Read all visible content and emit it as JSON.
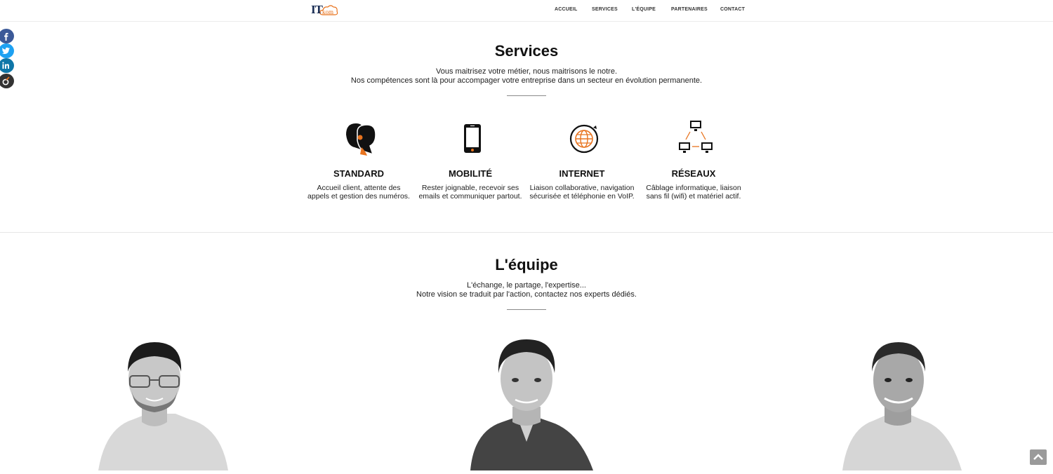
{
  "header": {
    "logo": {
      "main": "IT",
      "accent": "kom"
    },
    "nav": [
      {
        "label": "ACCUEIL"
      },
      {
        "label": "SERVICES"
      },
      {
        "label": "L'ÉQUIPE"
      },
      {
        "label": "PARTENAIRES"
      },
      {
        "label": "CONTACT"
      }
    ]
  },
  "social": [
    {
      "icon": "facebook-icon",
      "color": "#3b5998"
    },
    {
      "icon": "twitter-icon",
      "color": "#1da1f2"
    },
    {
      "icon": "linkedin-icon",
      "color": "#0e76a8"
    },
    {
      "icon": "viadeo-icon",
      "color": "#333333"
    }
  ],
  "services": {
    "title": "Services",
    "subtitle_line1": "Vous maitrisez votre métier, nous maitrisons le notre.",
    "subtitle_line2": "Nos compétences sont là pour accompager votre entreprise dans un secteur en évolution permanente.",
    "items": [
      {
        "icon": "call-center-icon",
        "title": "STANDARD",
        "desc": "Accueil client, attente des appels et gestion des numéros."
      },
      {
        "icon": "smartphone-icon",
        "title": "MOBILITÉ",
        "desc": "Rester joignable, recevoir ses emails et communiquer partout."
      },
      {
        "icon": "globe-icon",
        "title": "INTERNET",
        "desc": "Liaison collaborative, navigation sécurisée et téléphonie en VoIP."
      },
      {
        "icon": "network-icon",
        "title": "RÉSEAUX",
        "desc": "Câblage informatique, liaison sans fil (wifi) et matériel actif."
      }
    ]
  },
  "team": {
    "title": "L'équipe",
    "subtitle_line1": "L'échange, le partage, l'expertise...",
    "subtitle_line2": "Notre vision se traduit par l'action, contactez nos experts dédiés."
  },
  "colors": {
    "accent": "#e8731e",
    "text": "#111111"
  }
}
